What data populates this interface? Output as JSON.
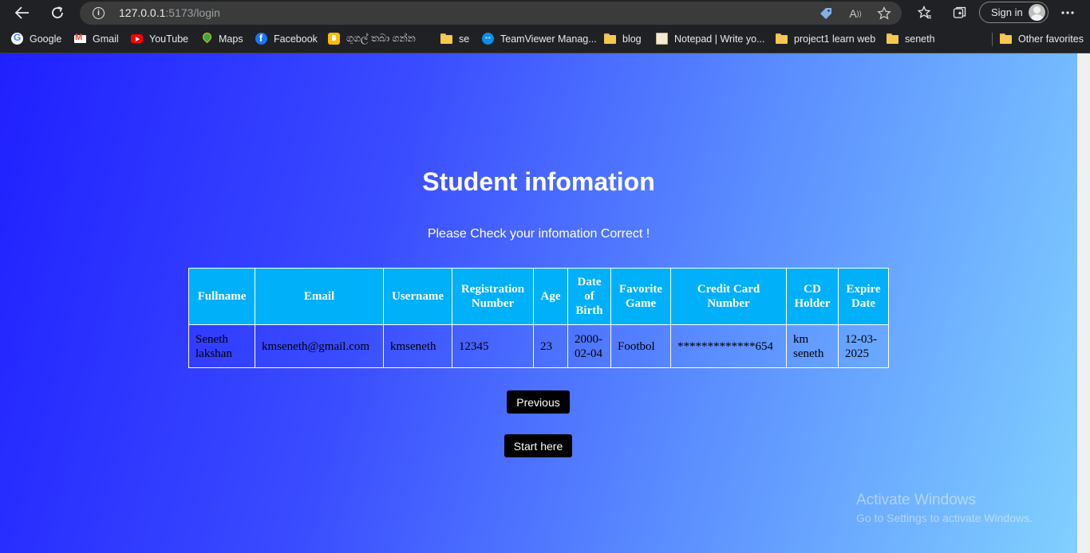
{
  "browser": {
    "url_host": "127.0.0.1",
    "url_rest": ":5173/login",
    "signin_label": "Sign in",
    "icons": {
      "back": "back-arrow-icon",
      "refresh": "refresh-icon",
      "info": "info-icon",
      "coupon": "coupon-tag-icon",
      "read_aloud": "read-aloud-icon",
      "add_favorite": "add-favorite-icon",
      "favorites": "favorites-icon",
      "collections": "collections-icon",
      "more": "more-menu-icon"
    }
  },
  "bookmarks": [
    {
      "label": "Google",
      "icon": "google"
    },
    {
      "label": "Gmail",
      "icon": "gmail"
    },
    {
      "label": "YouTube",
      "icon": "youtube"
    },
    {
      "label": "Maps",
      "icon": "maps"
    },
    {
      "label": "Facebook",
      "icon": "facebook"
    },
    {
      "label": "ගුගල් තබා ගන්න",
      "icon": "keep"
    },
    {
      "label": "se",
      "icon": "folder"
    },
    {
      "label": "TeamViewer Manag...",
      "icon": "teamviewer"
    },
    {
      "label": "blog",
      "icon": "folder"
    },
    {
      "label": "Notepad | Write yo...",
      "icon": "notepad"
    },
    {
      "label": "project1 learn web",
      "icon": "folder"
    },
    {
      "label": "seneth",
      "icon": "folder"
    }
  ],
  "other_favorites": "Other favorites",
  "page": {
    "title": "Student infomation",
    "subtitle": "Please Check your infomation Correct !",
    "table": {
      "headers": [
        "Fullname",
        "Email",
        "Username",
        "Registration Number",
        "Age",
        "Date of Birth",
        "Favorite Game",
        "Credit Card Number",
        "CD Holder",
        "Expire Date"
      ],
      "rows": [
        [
          "Seneth lakshan",
          "kmseneth@gmail.com",
          "kmseneth",
          "12345",
          "23",
          "2000-02-04",
          "Footbol",
          "*************654",
          "km seneth",
          "12-03-2025"
        ]
      ]
    },
    "previous_label": "Previous",
    "start_label": "Start here"
  },
  "watermark": {
    "line1": "Activate Windows",
    "line2": "Go to Settings to activate Windows."
  },
  "colors": {
    "header_cell": "#00b0f8",
    "button": "#000000",
    "gradient_start": "#2020ff",
    "gradient_end": "#80d0ff"
  }
}
